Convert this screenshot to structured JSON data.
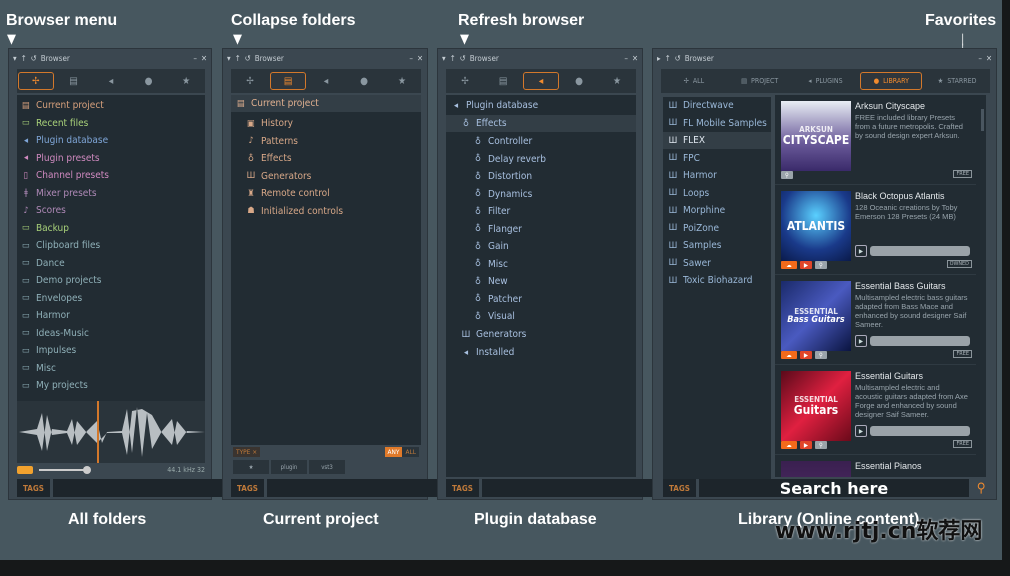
{
  "labels": {
    "browser_menu": "Browser menu",
    "collapse": "Collapse folders",
    "refresh": "Refresh browser",
    "favorites": "Favorites"
  },
  "captions": {
    "p1": "All folders",
    "p2": "Current project",
    "p3": "Plugin database",
    "p4": "Library (Online content)"
  },
  "watermark": "www.rjtj.cn软荐网",
  "browser_title": "Browser",
  "tags_label": "TAGS",
  "panel1": {
    "items": [
      {
        "label": "Current project",
        "color": "#d7a07c",
        "icon": "▤"
      },
      {
        "label": "Recent files",
        "color": "#a9d27a",
        "icon": "▭"
      },
      {
        "label": "Plugin database",
        "color": "#7fa6d8",
        "icon": "◂"
      },
      {
        "label": "Plugin presets",
        "color": "#d08ac0",
        "icon": "◂"
      },
      {
        "label": "Channel presets",
        "color": "#d08ac0",
        "icon": "▯"
      },
      {
        "label": "Mixer presets",
        "color": "#b08ab8",
        "icon": "ǂ"
      },
      {
        "label": "Scores",
        "color": "#b08ab8",
        "icon": "♪"
      },
      {
        "label": "Backup",
        "color": "#a9d27a",
        "icon": "▭"
      },
      {
        "label": "Clipboard files",
        "color": "#8fb0b8",
        "icon": "▭"
      },
      {
        "label": "Dance",
        "color": "#8fb0b8",
        "icon": "▭"
      },
      {
        "label": "Demo projects",
        "color": "#8fb0b8",
        "icon": "▭"
      },
      {
        "label": "Envelopes",
        "color": "#8fb0b8",
        "icon": "▭"
      },
      {
        "label": "Harmor",
        "color": "#8fb0b8",
        "icon": "▭"
      },
      {
        "label": "Ideas-Music",
        "color": "#8fb0b8",
        "icon": "▭"
      },
      {
        "label": "Impulses",
        "color": "#8fb0b8",
        "icon": "▭"
      },
      {
        "label": "Misc",
        "color": "#8fb0b8",
        "icon": "▭"
      },
      {
        "label": "My projects",
        "color": "#8fb0b8",
        "icon": "▭"
      }
    ],
    "sample_info": "44.1 kHz 32"
  },
  "panel2": {
    "header": "Current project",
    "items": [
      "History",
      "Patterns",
      "Effects",
      "Generators",
      "Remote control",
      "Initialized controls"
    ],
    "type_label": "TYPE ×",
    "any": "ANY",
    "all": "ALL",
    "filter_buttons": [
      "★",
      "plugin",
      "vst3"
    ]
  },
  "panel3": {
    "root": "Plugin database",
    "effects": "Effects",
    "children": [
      "Controller",
      "Delay reverb",
      "Distortion",
      "Dynamics",
      "Filter",
      "Flanger",
      "Gain",
      "Misc",
      "New",
      "Patcher",
      "Visual"
    ],
    "generators": "Generators",
    "installed": "Installed"
  },
  "panel4": {
    "tabs": [
      "ALL",
      "PROJECT",
      "PLUGINS",
      "LIBRARY",
      "STARRED"
    ],
    "folders": [
      "Directwave",
      "FL Mobile Samples",
      "FLEX",
      "FPC",
      "Harmor",
      "Loops",
      "Morphine",
      "PoiZone",
      "Samples",
      "Sawer",
      "Toxic Biohazard"
    ],
    "selected_folder": "FLEX",
    "cards": [
      {
        "title": "Arksun Cityscape",
        "desc": "FREE included library Presets from a future metropolis. Crafted by sound design expert Arksun.",
        "badge": "FREE",
        "art1": "ARKSUN",
        "art2": "CITYSCAPE",
        "bg": "linear-gradient(#e8eef4,#6a5a9a 60%,#3a2a6a)"
      },
      {
        "title": "Black Octopus Atlantis",
        "desc": "128 Oceanic creations by Toby Emerson 128 Presets (24 MB)",
        "badge": "OWNED",
        "art1": "",
        "art2": "ATLANTIS",
        "bg": "radial-gradient(circle at 50% 35%,#5ad0ff,#1a3a8a 60%,#0a1a4a)"
      },
      {
        "title": "Essential Bass Guitars",
        "desc": "Multisampled electric bass guitars adapted from Bass Mace and enhanced by sound designer Saif Sameer.",
        "badge": "FREE",
        "art1": "ESSENTIAL",
        "art2": "Bass Guitars",
        "bg": "linear-gradient(135deg,#1a2a6a,#4a5ac0,#0a1440)"
      },
      {
        "title": "Essential Guitars",
        "desc": "Multisampled electric and acoustic guitars adapted from Axe Forge and enhanced by sound designer Saif Sameer.",
        "badge": "FREE",
        "art1": "ESSENTIAL",
        "art2": "Guitars",
        "bg": "linear-gradient(135deg,#5a0a1a,#e02040,#6a0a1a)"
      },
      {
        "title": "Essential Pianos",
        "desc": "",
        "badge": "",
        "art1": "",
        "art2": "",
        "bg": "linear-gradient(#3a2050,#5a3070)"
      }
    ],
    "search_hint": "Search here"
  }
}
